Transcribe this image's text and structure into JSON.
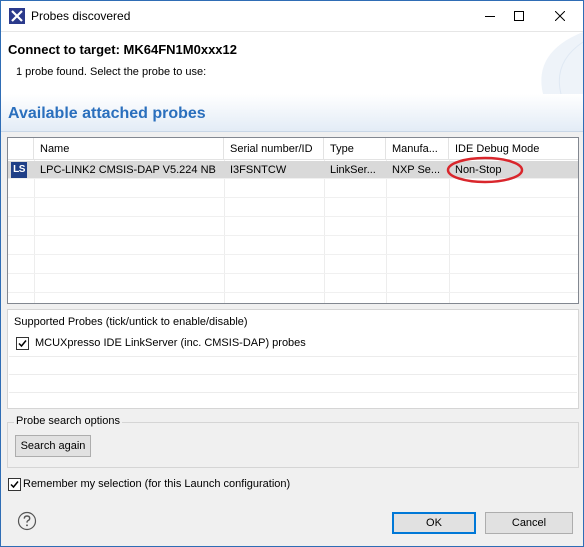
{
  "window": {
    "title": "Probes discovered",
    "accent": "#2f6db5"
  },
  "header": {
    "title": "Connect to target: MK64FN1M0xxx12",
    "message": "1 probe found. Select the probe to use:"
  },
  "section": {
    "title": "Available attached probes",
    "color": "#2a6fbd"
  },
  "probes": {
    "columns": [
      "Name",
      "Serial number/ID",
      "Type",
      "Manufa...",
      "IDE Debug Mode"
    ],
    "rows": [
      {
        "icon": "LS",
        "name": "LPC-LINK2 CMSIS-DAP V5.224 NB",
        "serial": "I3FSNTCW",
        "type": "LinkSer...",
        "manufacturer": "NXP Se...",
        "debug_mode": "Non-Stop"
      }
    ],
    "annotation_color": "#d9262c"
  },
  "supported": {
    "label": "Supported Probes (tick/untick to enable/disable)",
    "items": [
      {
        "label": "MCUXpresso IDE LinkServer (inc. CMSIS-DAP) probes",
        "checked": true
      }
    ]
  },
  "search": {
    "label": "Probe search options",
    "button": "Search again"
  },
  "remember": {
    "label": "Remember my selection (for this Launch configuration)",
    "checked": true
  },
  "footer": {
    "ok": "OK",
    "cancel": "Cancel",
    "help_icon": "help-icon"
  }
}
